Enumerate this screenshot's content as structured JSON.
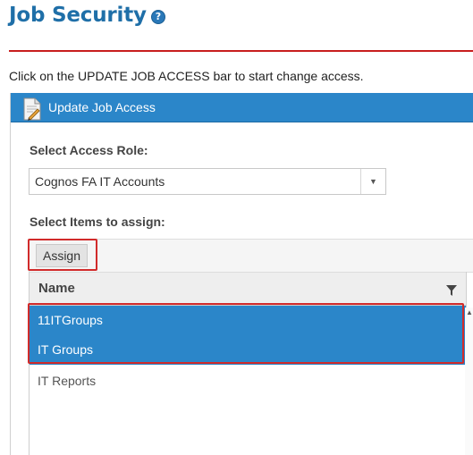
{
  "page": {
    "title": "Job Security",
    "help_icon_glyph": "?",
    "instruction": "Click on the UPDATE JOB ACCESS bar to start change access."
  },
  "panel": {
    "header_label": "Update Job Access",
    "header_icon": "document-edit-icon",
    "role_label": "Select Access Role:",
    "role_select": {
      "value": "Cognos FA IT Accounts",
      "arrow": "▼"
    },
    "items_label": "Select Items to assign:",
    "assign_button": "Assign"
  },
  "grid": {
    "column_header": "Name",
    "filter_icon": "filter-icon",
    "rows": [
      {
        "name": "11ITGroups",
        "selected": true
      },
      {
        "name": "IT Groups",
        "selected": true
      },
      {
        "name": "IT Reports",
        "selected": false
      }
    ]
  },
  "colors": {
    "accent": "#2b86c9",
    "title": "#1f6fa8",
    "highlight": "#d12b2b"
  }
}
